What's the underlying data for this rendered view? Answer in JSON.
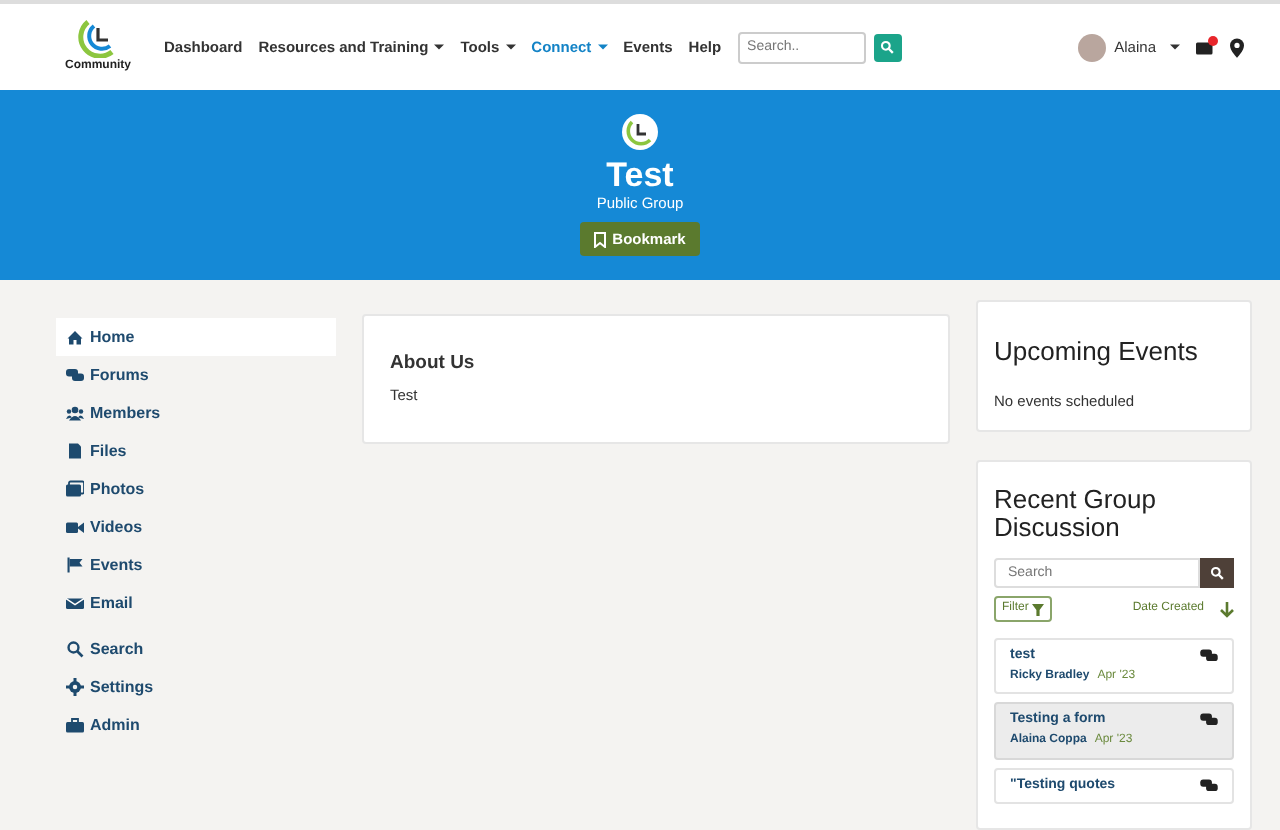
{
  "navbar": {
    "logo_text": "Community",
    "links": [
      {
        "label": "Dashboard",
        "dropdown": false,
        "selected": false
      },
      {
        "label": "Resources and Training",
        "dropdown": true,
        "selected": false
      },
      {
        "label": "Tools",
        "dropdown": true,
        "selected": false
      },
      {
        "label": "Connect",
        "dropdown": true,
        "selected": true
      },
      {
        "label": "Events",
        "dropdown": false,
        "selected": false
      },
      {
        "label": "Help",
        "dropdown": false,
        "selected": false
      }
    ],
    "search": {
      "placeholder": "Search.."
    },
    "user": {
      "name": "Alaina"
    },
    "notifications": true
  },
  "hero": {
    "title": "Test",
    "subtitle": "Public Group",
    "button": "Bookmark"
  },
  "sidebar": {
    "items": [
      {
        "label": "Home",
        "kind": "home",
        "selected": true
      },
      {
        "label": "Forums",
        "kind": "forums",
        "selected": false
      },
      {
        "label": "Members",
        "kind": "members",
        "selected": false
      },
      {
        "label": "Files",
        "kind": "file",
        "selected": false
      },
      {
        "label": "Photos",
        "kind": "photos",
        "selected": false
      },
      {
        "label": "Videos",
        "kind": "video",
        "selected": false
      },
      {
        "label": "Events",
        "kind": "flag",
        "selected": false
      },
      {
        "label": "Email",
        "kind": "email",
        "selected": false
      }
    ],
    "tools": [
      {
        "label": "Search",
        "kind": "search",
        "selected": false
      },
      {
        "label": "Settings",
        "kind": "gear",
        "selected": false
      },
      {
        "label": "Admin",
        "kind": "briefcase",
        "selected": false
      }
    ]
  },
  "about": {
    "title": "About Us",
    "text": "Test"
  },
  "upcoming_events": {
    "title": "Upcoming Events",
    "empty": "No events scheduled"
  },
  "discussion": {
    "title": "Recent Group Discussion",
    "search": {
      "placeholder": "Search"
    },
    "filter": "Filter",
    "sort": "Date Created",
    "items": [
      {
        "title": "test",
        "author": "Ricky Bradley",
        "date": "Apr '23",
        "selected": false
      },
      {
        "title": "Testing a form",
        "author": "Alaina Coppa",
        "date": "Apr '23",
        "selected": true
      },
      {
        "title": "\"Testing quotes",
        "selected": false
      }
    ]
  }
}
